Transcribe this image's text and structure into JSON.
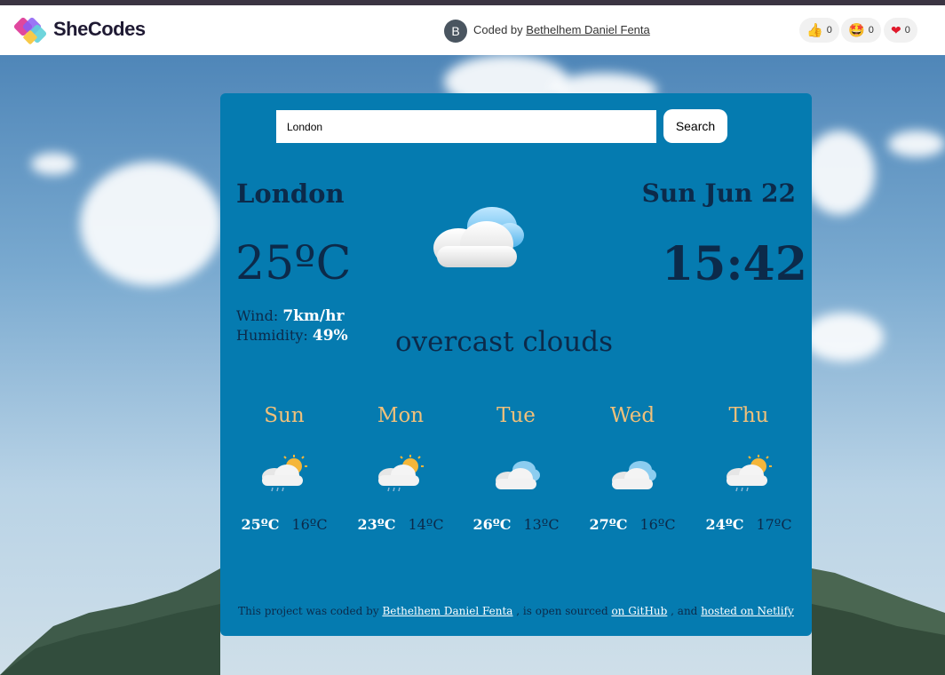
{
  "header": {
    "brand": "SheCodes",
    "avatar_initial": "B",
    "coded_by_label": "Coded by",
    "author": "Bethelhem Daniel Fenta",
    "reactions": [
      {
        "icon": "thumbs-up-icon",
        "count": "0"
      },
      {
        "icon": "star-struck-icon",
        "count": "0"
      },
      {
        "icon": "heart-icon",
        "count": "0"
      }
    ]
  },
  "search": {
    "value": "London",
    "button_label": "Search"
  },
  "current": {
    "city": "London",
    "temperature": "25ºC",
    "wind_label": "Wind:",
    "wind_value": "7km/hr",
    "humidity_label": "Humidity:",
    "humidity_value": "49%",
    "description": "overcast clouds",
    "date": "Sun Jun 22",
    "time": "15:42",
    "icon": "cloud-icon"
  },
  "forecast": [
    {
      "day": "Sun",
      "max": "25ºC",
      "min": "16ºC",
      "icon": "sun-cloud-rain-icon"
    },
    {
      "day": "Mon",
      "max": "23ºC",
      "min": "14ºC",
      "icon": "sun-cloud-rain-icon"
    },
    {
      "day": "Tue",
      "max": "26ºC",
      "min": "13ºC",
      "icon": "cloud-icon"
    },
    {
      "day": "Wed",
      "max": "27ºC",
      "min": "16ºC",
      "icon": "cloud-icon"
    },
    {
      "day": "Thu",
      "max": "24ºC",
      "min": "17ºC",
      "icon": "sun-cloud-rain-icon"
    }
  ],
  "footer": {
    "text1": "This project was coded by",
    "author_link": "Bethelhem Daniel Fenta",
    "text2": ", is open sourced",
    "github_link": "on GitHub",
    "text3": ", and",
    "netlify_link": "hosted on Netlify"
  },
  "colors": {
    "card_bg": "#057bb0",
    "day_name": "#f0c07a",
    "dark_text": "#0c2a4a"
  }
}
